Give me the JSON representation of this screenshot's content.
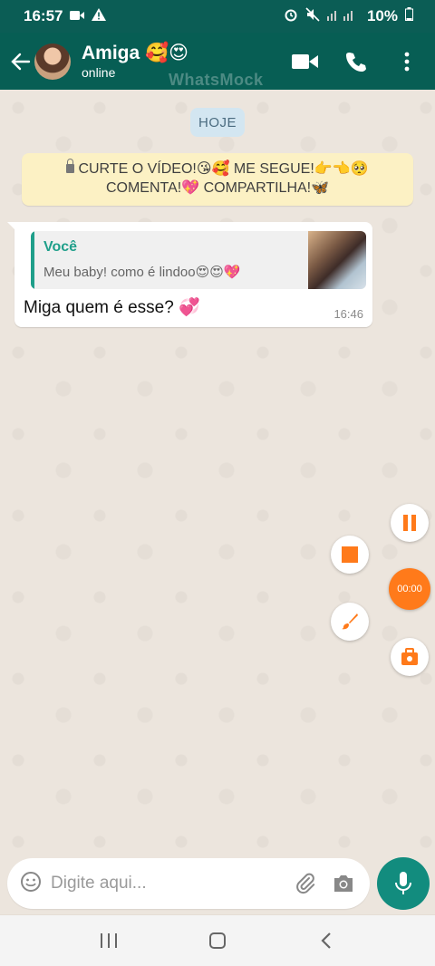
{
  "status_bar": {
    "time": "16:57",
    "battery": "10%"
  },
  "header": {
    "contact_name": "Amiga 🥰😍",
    "contact_status": "online",
    "watermark": "WhatsMock"
  },
  "chat": {
    "date_chip": "HOJE",
    "notice_line1": "CURTE O VÍDEO!😘🥰 ME SEGUE!👉👈🥺",
    "notice_line2": "COMENTA!💖 COMPARTILHA!🦋",
    "message": {
      "quoted_author": "Você",
      "quoted_text": "Meu baby! como é lindoo😍😍💖",
      "text": "Miga quem é esse? 💞",
      "time": "16:46"
    }
  },
  "recorder": {
    "timer": "00:00"
  },
  "input": {
    "placeholder": "Digite aqui..."
  },
  "colors": {
    "header": "#075e54",
    "accent": "#128c7e",
    "recorder": "#ff7a1a"
  }
}
